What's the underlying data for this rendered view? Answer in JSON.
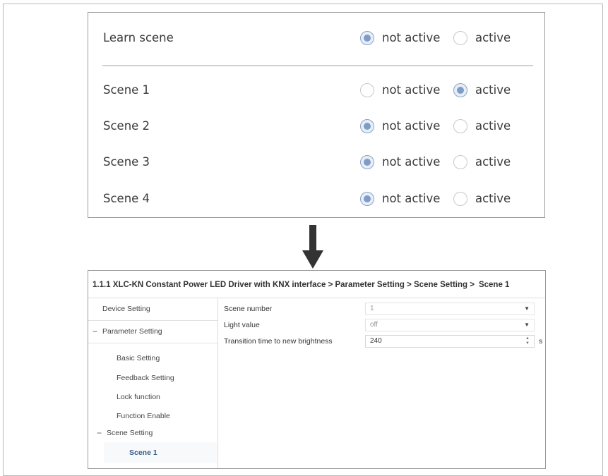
{
  "top_panel": {
    "learn_scene": {
      "label": "Learn scene",
      "selected": "not active"
    },
    "scenes": [
      {
        "label": "Scene 1",
        "selected": "active"
      },
      {
        "label": "Scene 2",
        "selected": "not active"
      },
      {
        "label": "Scene 3",
        "selected": "not active"
      },
      {
        "label": "Scene 4",
        "selected": "not active"
      }
    ],
    "option_not_active": "not active",
    "option_active": "active"
  },
  "arrow_icon": "down-arrow-icon",
  "bottom_panel": {
    "breadcrumb": "1.1.1 XLC-KN Constant Power LED Driver with KNX interface > Parameter Setting > Scene Setting >",
    "breadcrumb_current": "Scene 1",
    "sidebar": {
      "device_setting": "Device Setting",
      "parameter_setting": "Parameter Setting",
      "basic_setting": "Basic Setting",
      "feedback_setting": "Feedback Setting",
      "lock_function": "Lock function",
      "function_enable": "Function Enable",
      "scene_setting": "Scene Setting",
      "scene_1": "Scene 1",
      "collapse_symbol": "−"
    },
    "params": {
      "scene_number": {
        "label": "Scene number",
        "value": "1"
      },
      "light_value": {
        "label": "Light value",
        "value": "off"
      },
      "transition_time": {
        "label": "Transition time to new brightness",
        "value": "240",
        "unit": "s"
      }
    }
  }
}
